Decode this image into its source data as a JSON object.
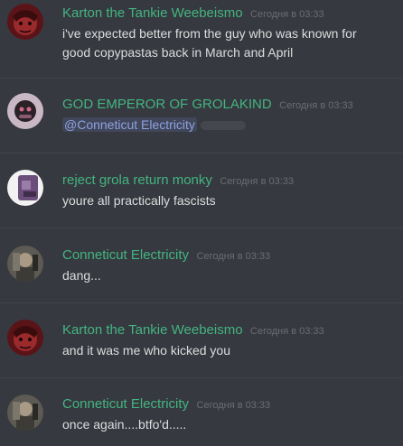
{
  "colors": {
    "background": "#36393f",
    "username_green": "#43b581",
    "timestamp": "#6a6d72",
    "message_text": "#dcddde",
    "mention_text": "#8ea1e1"
  },
  "messages": [
    {
      "username": "Karton the Tankie Weebeismo",
      "timestamp": "Сегодня в 03:33",
      "text": "i've expected better from the guy who was known for good copypastas back in March and April",
      "avatar_icon": "red-anime-avatar"
    },
    {
      "username": "GOD EMPEROR OF GROLAKIND",
      "timestamp": "Сегодня в 03:33",
      "mention": "@Conneticut Electricity",
      "avatar_icon": "masked-figure-avatar"
    },
    {
      "username": "reject grola return monky",
      "timestamp": "Сегодня в 03:33",
      "text": "youre all practically fascists",
      "avatar_icon": "purple-figure-avatar"
    },
    {
      "username": "Conneticut Electricity",
      "timestamp": "Сегодня в 03:33",
      "text": "dang...",
      "avatar_icon": "soldier-avatar"
    },
    {
      "username": "Karton the Tankie Weebeismo",
      "timestamp": "Сегодня в 03:33",
      "text": "and it was me who kicked you",
      "avatar_icon": "red-anime-avatar"
    },
    {
      "username": "Conneticut Electricity",
      "timestamp": "Сегодня в 03:33",
      "text": "once again....btfo'd.....",
      "avatar_icon": "soldier-avatar"
    }
  ]
}
